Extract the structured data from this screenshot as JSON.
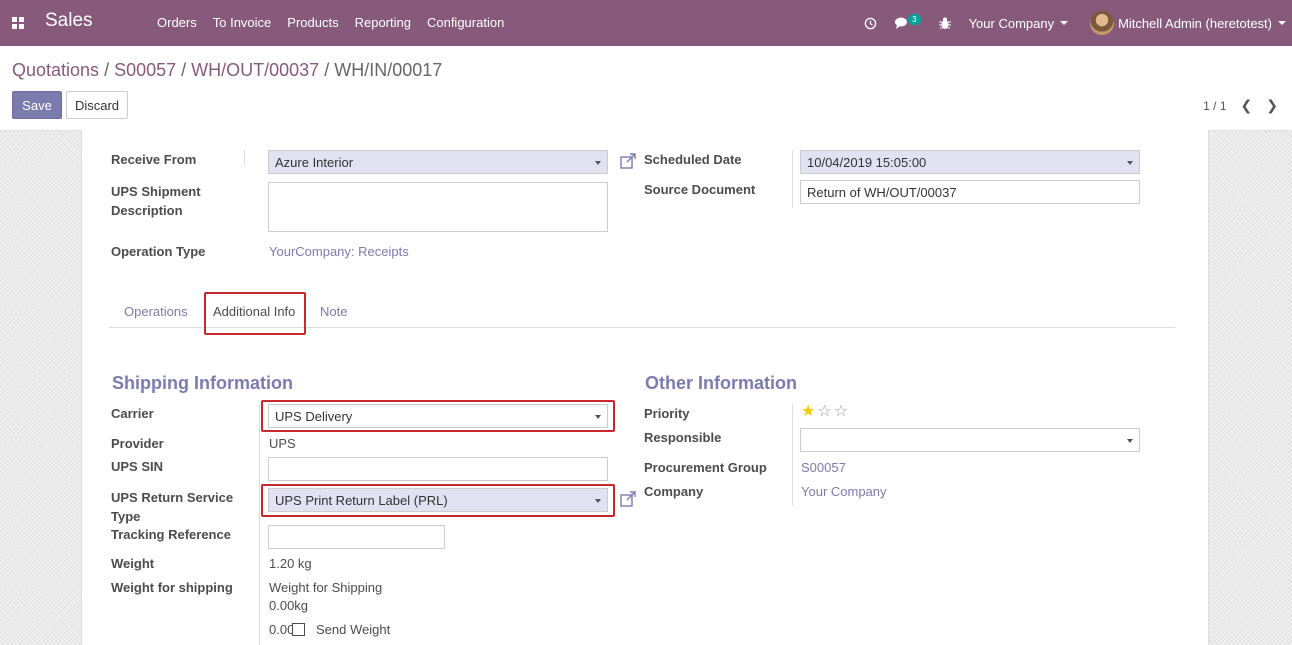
{
  "navbar": {
    "app_name": "Sales",
    "menu": [
      "Orders",
      "To Invoice",
      "Products",
      "Reporting",
      "Configuration"
    ],
    "chat_badge": "3",
    "company": "Your Company",
    "user": "Mitchell Admin (heretotest)"
  },
  "breadcrumb": {
    "items": [
      "Quotations",
      "S00057",
      "WH/OUT/00037"
    ],
    "current": "WH/IN/00017",
    "separator": " / "
  },
  "buttons": {
    "save": "Save",
    "discard": "Discard"
  },
  "pager": {
    "value": "1 / 1"
  },
  "form": {
    "receive_from_label": "Receive From",
    "receive_from_value": "Azure Interior",
    "ups_shipment_label_1": "UPS Shipment",
    "ups_shipment_label_2": "Description",
    "operation_type_label": "Operation Type",
    "operation_type_value": "YourCompany: Receipts",
    "scheduled_date_label": "Scheduled Date",
    "scheduled_date_value": "10/04/2019 15:05:00",
    "source_document_label": "Source Document",
    "source_document_value": "Return of WH/OUT/00037"
  },
  "tabs": [
    "Operations",
    "Additional Info",
    "Note"
  ],
  "shipping": {
    "title": "Shipping Information",
    "carrier_label": "Carrier",
    "carrier_value": "UPS Delivery",
    "provider_label": "Provider",
    "provider_value": "UPS",
    "ups_sin_label": "UPS SIN",
    "return_service_label_1": "UPS Return Service",
    "return_service_label_2": "Type",
    "return_service_value": "UPS Print Return Label (PRL)",
    "tracking_label": "Tracking Reference",
    "weight_label": "Weight",
    "weight_value": "1.20 kg",
    "weight_shipping_label": "Weight for shipping",
    "weight_shipping_line1": "Weight for Shipping",
    "weight_shipping_line2": "0.00kg",
    "send_weight_value": "0.00",
    "send_weight_label": "Send Weight"
  },
  "other": {
    "title": "Other Information",
    "priority_label": "Priority",
    "priority_stars": 1,
    "priority_max": 3,
    "responsible_label": "Responsible",
    "procurement_label": "Procurement Group",
    "procurement_value": "S00057",
    "company_label": "Company",
    "company_value": "Your Company"
  },
  "colors": {
    "navbar": "#875a7b",
    "accent": "#7c7bad",
    "highlight": "#c6282e",
    "star": "#f3cc00"
  }
}
